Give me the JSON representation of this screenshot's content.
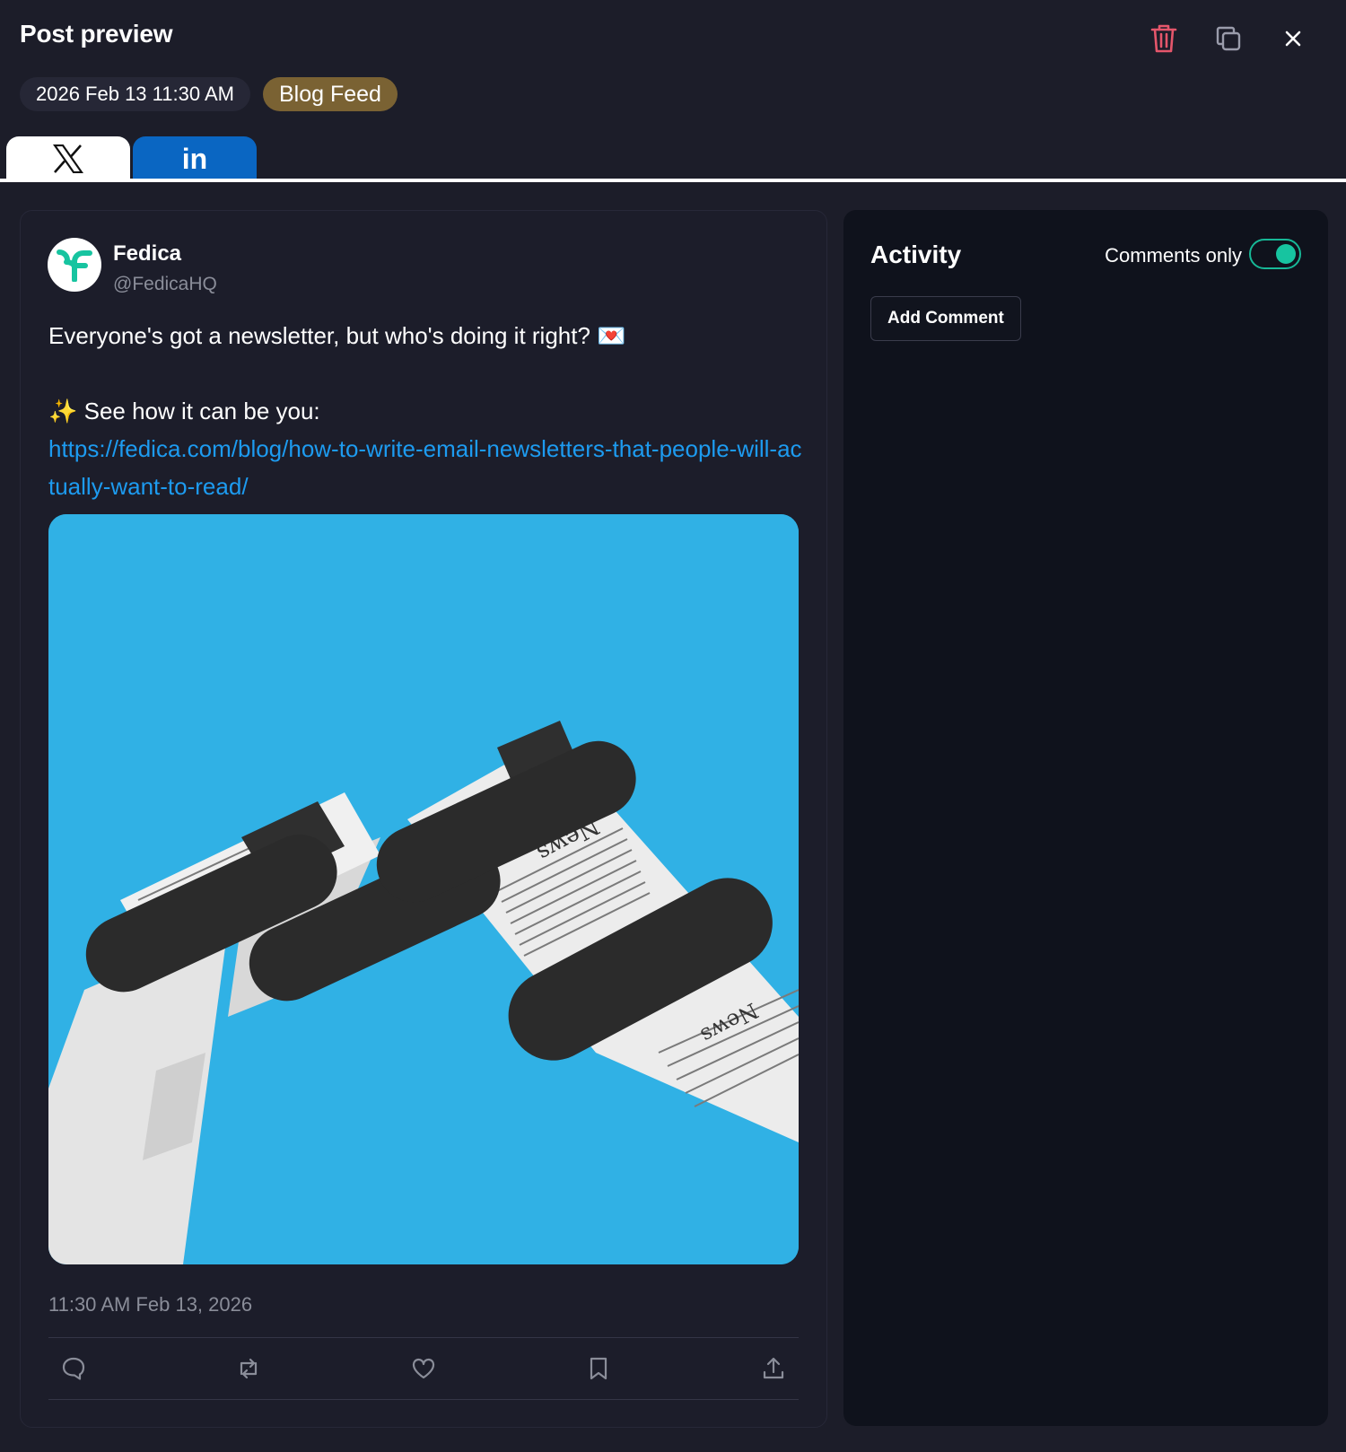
{
  "header": {
    "title": "Post preview",
    "scheduled_date": "2026 Feb 13 11:30 AM",
    "feed_tag": "Blog Feed"
  },
  "tabs": [
    {
      "label": "𝕏",
      "icon": "x-logo-icon",
      "active": true
    },
    {
      "label": "in",
      "icon": "linkedin-logo-icon",
      "active": false
    }
  ],
  "post": {
    "account_name": "Fedica",
    "account_handle": "@FedicaHQ",
    "line1": "Everyone's got a newsletter, but who's doing it right? 💌",
    "line2": "✨ See how it can be you:",
    "link": "https://fedica.com/blog/how-to-write-email-newsletters-that-people-will-actually-want-to-read/",
    "image_text_1": "News",
    "image_text_2": "News",
    "timestamp": "11:30 AM Feb 13, 2026"
  },
  "activity": {
    "title": "Activity",
    "toggle_label": "Comments only",
    "toggle_on": true,
    "add_comment_label": "Add Comment"
  },
  "colors": {
    "background": "#1c1d29",
    "accent_teal": "#17c4a0",
    "delete_red": "#e5566b",
    "link_blue": "#1d9bf0",
    "tag_brown": "#7a6233",
    "linkedin_blue": "#0a66c2",
    "image_sky": "#30b1e5"
  }
}
